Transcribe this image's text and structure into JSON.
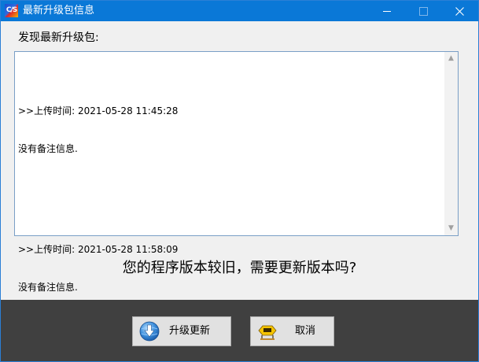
{
  "window": {
    "title": "最新升级包信息",
    "app_icon_text": "C/S"
  },
  "main": {
    "header_label": "发现最新升级包:",
    "log_entries": [
      {
        "line1": ">>上传时间: 2021-05-28 11:45:28",
        "line2": "没有备注信息."
      },
      {
        "line1": ">>上传时间: 2021-05-28 11:58:09",
        "line2": "没有备注信息."
      }
    ],
    "question": "您的程序版本较旧，需要更新版本吗?"
  },
  "buttons": {
    "upgrade_label": "升级更新",
    "upgrade_icon": "download-globe-icon",
    "cancel_label": "取消",
    "cancel_icon": "exit-sign-icon"
  },
  "colors": {
    "titlebar": "#0a78d7",
    "bottom_panel": "#404040",
    "button_face": "#e1e1e1"
  }
}
